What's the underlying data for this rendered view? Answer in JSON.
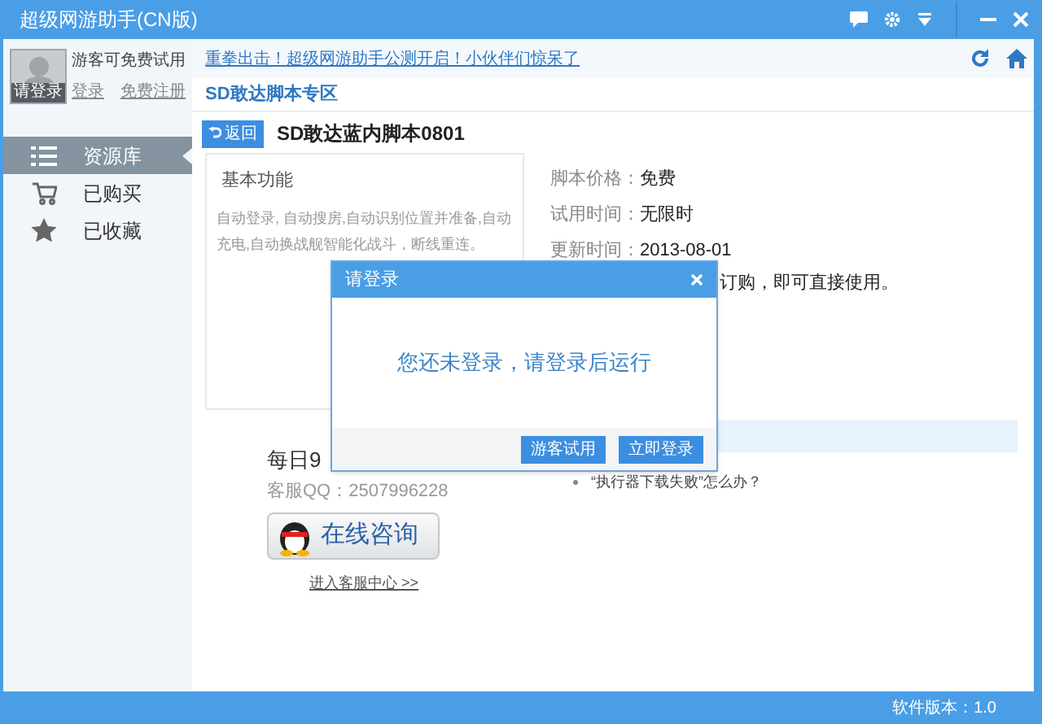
{
  "window": {
    "title": "超级网游助手(CN版)"
  },
  "user": {
    "avatar_label": "请登录",
    "status": "游客可免费试用",
    "links": [
      "登录",
      "免费注册"
    ]
  },
  "nav": [
    {
      "label": "资源库",
      "selected": true
    },
    {
      "label": "已购买",
      "selected": false
    },
    {
      "label": "已收藏",
      "selected": false
    }
  ],
  "banner_link": "重拳出击！超级网游助手公测开启！小伙伴们惊呆了",
  "section_title": "SD敢达脚本专区",
  "back_button": "返回",
  "script_title": "SD敢达蓝内脚本0801",
  "card": {
    "title": "基本功能",
    "description": "自动登录, 自动搜房,自动识别位置并准备,自动充电,自动换战舰智能化战斗，断线重连。"
  },
  "info": [
    {
      "label": "脚本价格：",
      "value": "免费"
    },
    {
      "label": "试用时间：",
      "value": "无限时"
    },
    {
      "label": "更新时间：",
      "value": "2013-08-01"
    }
  ],
  "notice_fragment": "订购，即可直接使用。",
  "hotline_fragment": "每日9",
  "qq": "客服QQ：2507996228",
  "consult_button": "在线咨询",
  "service_link": "进入客服中心 >>",
  "faq": [
    "“执行器下载失败”怎么办？"
  ],
  "status_bar": "软件版本：1.0",
  "dialog": {
    "title": "请登录",
    "message": "您还未登录，请登录后运行",
    "buttons": [
      "游客试用",
      "立即登录"
    ]
  }
}
